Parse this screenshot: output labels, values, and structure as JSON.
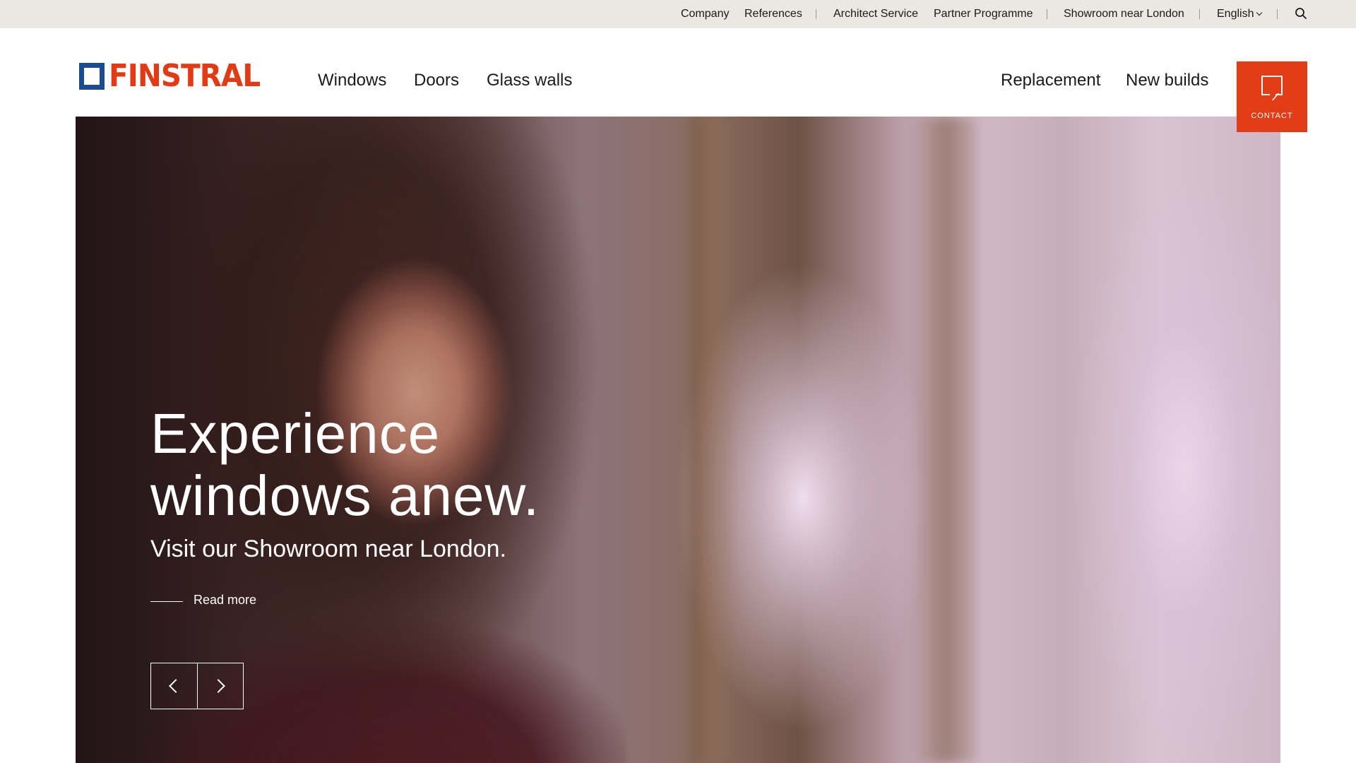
{
  "topbar": {
    "company": "Company",
    "references": "References",
    "architect_service": "Architect Service",
    "partner_programme": "Partner Programme",
    "showroom": "Showroom near London",
    "language": "English"
  },
  "logo": {
    "text": "FINSTRAL"
  },
  "nav": {
    "windows": "Windows",
    "doors": "Doors",
    "glass_walls": "Glass walls",
    "replacement": "Replacement",
    "new_builds": "New builds"
  },
  "contact": {
    "label": "CONTACT"
  },
  "hero": {
    "title": "Experience windows anew.",
    "subtitle": "Visit our Showroom near London.",
    "read_more": "Read more"
  },
  "colors": {
    "brand_red": "#e33d17",
    "brand_blue": "#1c4b91",
    "topbar_bg": "#ebe7e2"
  },
  "icons": {
    "search": "search-icon",
    "contact": "chat-bubble-icon",
    "prev": "chevron-left-icon",
    "next": "chevron-right-icon",
    "language_dropdown": "chevron-down-icon"
  }
}
